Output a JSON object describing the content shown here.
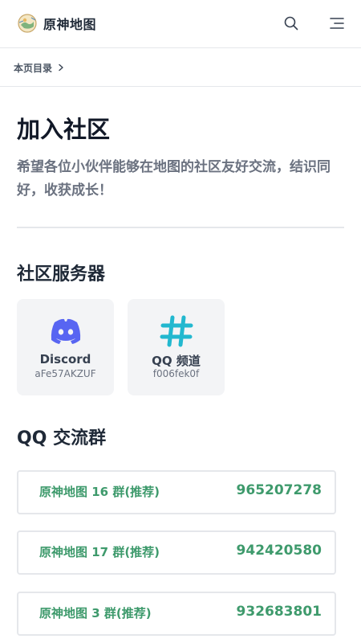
{
  "header": {
    "site_title": "原神地图",
    "logo_icon": "genshin-map-logo",
    "search_icon": "search-icon",
    "menu_icon": "menu-icon"
  },
  "toc": {
    "label": "本页目录",
    "icon": "chevron-right-icon"
  },
  "page": {
    "title": "加入社区",
    "intro": "希望各位小伙伴能够在地图的社区友好交流，结识同好，收获成长！"
  },
  "servers": {
    "heading": "社区服务器",
    "cards": [
      {
        "name": "Discord",
        "code": "aFe57AKZUF",
        "icon": "discord-icon",
        "color": "#5865f2"
      },
      {
        "name": "QQ 频道",
        "code": "f006fek0f",
        "icon": "hashtag-icon",
        "color": "#22b8cf"
      }
    ]
  },
  "groups": {
    "heading": "QQ 交流群",
    "items": [
      {
        "name": "原神地图 16 群(推荐)",
        "number": "965207278"
      },
      {
        "name": "原神地图 17 群(推荐)",
        "number": "942420580"
      },
      {
        "name": "原神地图 3 群(推荐)",
        "number": "932683801"
      }
    ],
    "accent_color": "#3e9a6c"
  }
}
